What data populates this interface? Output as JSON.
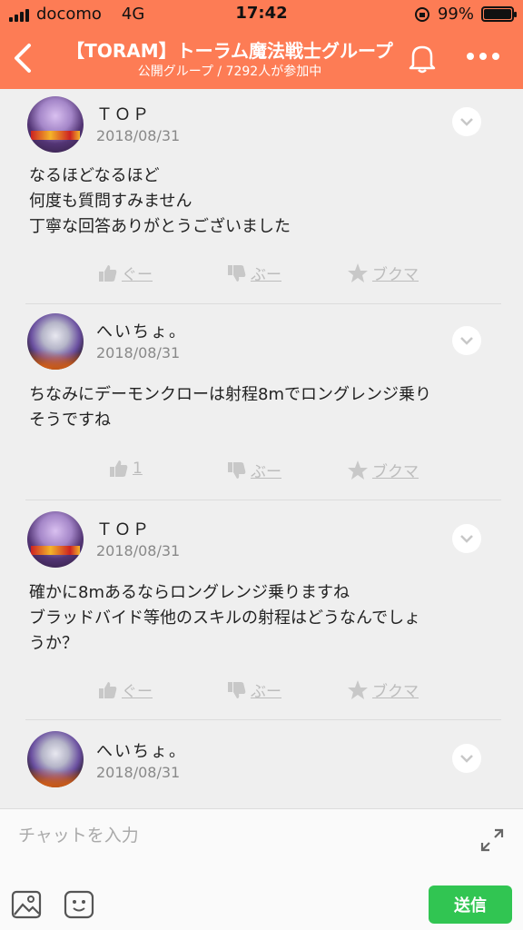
{
  "status_bar": {
    "carrier": "docomo",
    "network": "4G",
    "time": "17:42",
    "battery": "99%",
    "battery_level": 0.99
  },
  "header": {
    "title": "【TORAM】トーラム魔法戦士グループ",
    "subtitle": "公開グループ / 7292人が参加中",
    "background_color": "#fd7c55"
  },
  "messages": [
    {
      "name": "ＴＯＰ",
      "date": "2018/08/31",
      "lines": [
        "なるほどなるほど",
        "何度も質問すみません",
        "丁寧な回答ありがとうございました"
      ],
      "like": "ぐー",
      "dislike": "ぶー",
      "bookmark": "ブクマ"
    },
    {
      "name": "へいちょ。",
      "date": "2018/08/31",
      "lines": [
        "ちなみにデーモンクローは射程8mでロングレンジ乗り",
        "そうですね"
      ],
      "like": "1",
      "dislike": "ぶー",
      "bookmark": "ブクマ"
    },
    {
      "name": "ＴＯＰ",
      "date": "2018/08/31",
      "lines": [
        "確かに8mあるならロングレンジ乗りますね",
        "ブラッドバイド等他のスキルの射程はどうなんでしょ",
        "うか？"
      ],
      "like": "ぐー",
      "dislike": "ぶー",
      "bookmark": "ブクマ"
    },
    {
      "name": "へいちょ。",
      "date": "2018/08/31",
      "lines": [],
      "like": "",
      "dislike": "",
      "bookmark": ""
    }
  ],
  "composer": {
    "placeholder": "チャットを入力",
    "send_label": "送信",
    "send_color": "#31c552"
  },
  "icons": [
    "back-arrow-icon",
    "bell-icon",
    "more-icon",
    "chevron-down-icon",
    "thumbs-up-icon",
    "thumbs-down-icon",
    "star-icon",
    "expand-icon",
    "image-icon",
    "emoji-icon"
  ]
}
